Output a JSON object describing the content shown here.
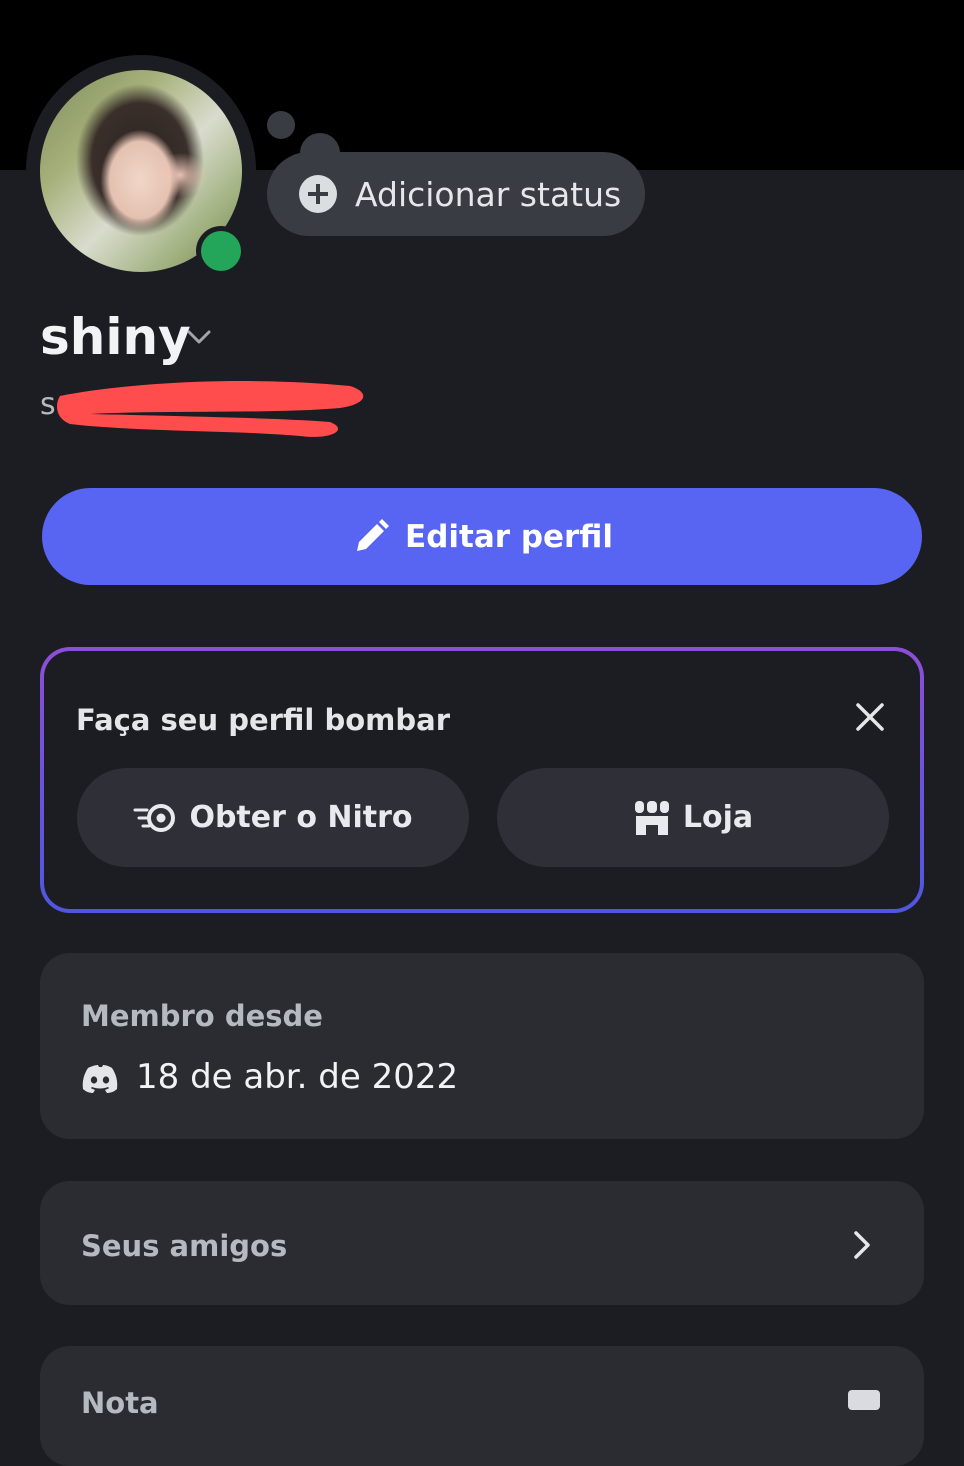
{
  "profile": {
    "status_button_label": "Adicionar status",
    "username": "shiny",
    "handle_visible": "s",
    "presence": "online",
    "presence_color": "#23a55a"
  },
  "actions": {
    "edit_label": "Editar perfil",
    "accent_color": "#5865f2"
  },
  "promo": {
    "title": "Faça seu perfil bombar",
    "nitro_label": "Obter o Nitro",
    "shop_label": "Loja"
  },
  "member": {
    "label": "Membro desde",
    "date": "18 de abr. de 2022"
  },
  "friends": {
    "label": "Seus amigos"
  },
  "note": {
    "label": "Nota"
  },
  "icons": [
    "plus-icon",
    "chevron-down-icon",
    "pencil-icon",
    "close-icon",
    "nitro-icon",
    "shop-icon",
    "discord-icon",
    "chevron-right-icon",
    "note-icon"
  ]
}
